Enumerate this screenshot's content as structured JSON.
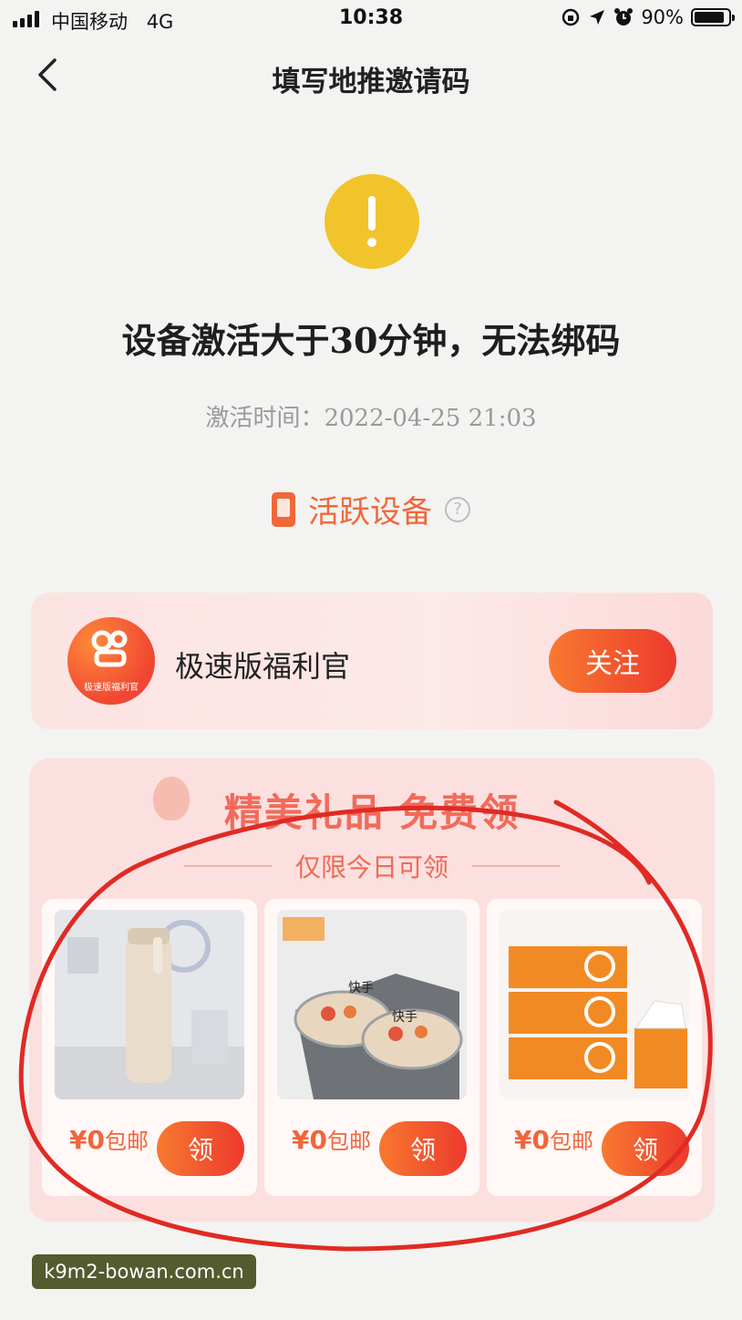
{
  "status_bar": {
    "carrier": "中国移动",
    "network": "4G",
    "time": "10:38",
    "battery": "90%",
    "battery_level": 0.9
  },
  "header": {
    "title": "填写地推邀请码",
    "back_icon": "chevron-left-icon"
  },
  "warning": {
    "icon": "exclamation-icon",
    "icon_color": "#f0c42a",
    "title": "设备激活大于30分钟，无法绑码",
    "activation_time": "激活时间：2022-04-25 21:03"
  },
  "active_device": {
    "label": "活跃设备",
    "icon": "phone-icon",
    "help_icon": "question-icon",
    "color": "#f0683a"
  },
  "follow_card": {
    "name": "极速版福利官",
    "avatar_caption": "极速版福利官",
    "button": "关注"
  },
  "gifts": {
    "title": "精美礼品 免费领",
    "subtitle": "仅限今日可领",
    "items": [
      {
        "price": "¥0",
        "note": "包邮",
        "button": "领",
        "image": "bottle"
      },
      {
        "price": "¥0",
        "note": "包邮",
        "button": "领",
        "image": "bowls",
        "image_text": "快手"
      },
      {
        "price": "¥0",
        "note": "包邮",
        "button": "领",
        "image": "tissues"
      }
    ]
  },
  "watermark": "k9m2-bowan.com.cn",
  "accent_color": "#ec3a2e"
}
